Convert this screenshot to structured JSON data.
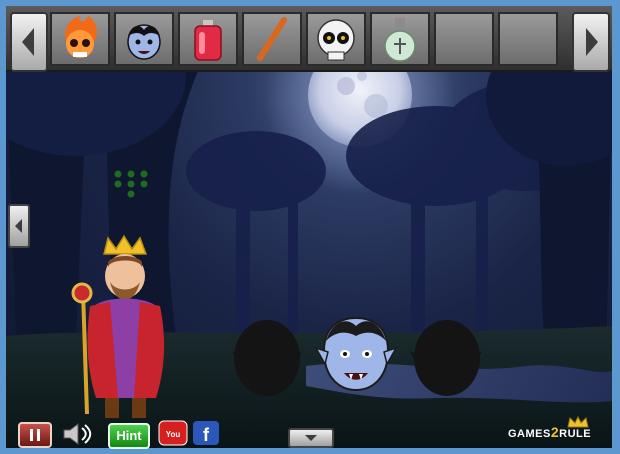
{
  "toolbar": {
    "items": [
      {
        "name": "flaming-skull-item",
        "icon": "flaming-skull-icon"
      },
      {
        "name": "vampire-face-item",
        "icon": "vampire-face-icon"
      },
      {
        "name": "red-potion-item",
        "icon": "red-potion-icon"
      },
      {
        "name": "orange-stick-item",
        "icon": "stick-icon"
      },
      {
        "name": "sugar-skull-item",
        "icon": "sugar-skull-icon"
      },
      {
        "name": "holy-water-item",
        "icon": "holy-water-icon"
      },
      {
        "name": "empty-slot",
        "icon": ""
      },
      {
        "name": "empty-slot",
        "icon": ""
      }
    ]
  },
  "scene": {
    "description_icons": [
      "moon",
      "king",
      "vampire-heads",
      "clover-dots"
    ]
  },
  "hud": {
    "hint_label": "Hint",
    "logo_text_left": "GAMES",
    "logo_number": "2",
    "logo_text_right": "RULE"
  }
}
